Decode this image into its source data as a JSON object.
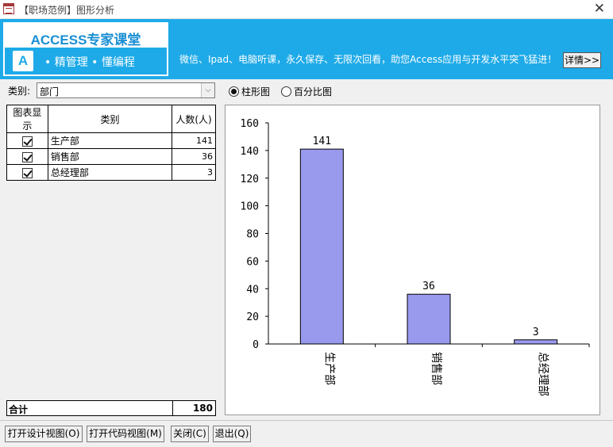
{
  "window": {
    "title": "【职场范例】图形分析",
    "close_glyph": "✕"
  },
  "banner": {
    "logo_title": "ACCESS专家课堂",
    "logo_badge": "A",
    "logo_slogan": "•  精管理  •  懂编程",
    "text": "微信、Ipad、电脑听课，永久保存、无限次回看，助您Access应用与开发水平突飞猛进！",
    "detail_button": "详情>>",
    "color": "#1eaae8"
  },
  "filter": {
    "label": "类别:",
    "value": "部门",
    "arrow": "⌵"
  },
  "chart_mode": {
    "options": [
      {
        "label": "柱形图",
        "selected": true
      },
      {
        "label": "百分比图",
        "selected": false
      }
    ]
  },
  "table": {
    "headers": [
      "图表显示",
      "类别",
      "人数(人)"
    ],
    "rows": [
      {
        "checked": true,
        "name": "生产部",
        "count": "141"
      },
      {
        "checked": true,
        "name": "销售部",
        "count": "36"
      },
      {
        "checked": true,
        "name": "总经理部",
        "count": "3"
      }
    ],
    "total_label": "合计",
    "total_value": "180"
  },
  "chart_data": {
    "type": "bar",
    "categories": [
      "生产部",
      "销售部",
      "总经理部"
    ],
    "values": [
      141,
      36,
      3
    ],
    "data_labels": [
      "141",
      "36",
      "3"
    ],
    "ylim": [
      0,
      160
    ],
    "yticks": [
      0,
      20,
      40,
      60,
      80,
      100,
      120,
      140,
      160
    ],
    "bar_color": "#9999ee",
    "grid": false,
    "legend": "none"
  },
  "buttons": {
    "design_view": "打开设计视图(O)",
    "code_view": "打开代码视图(M)",
    "close": "关闭(C)",
    "exit": "退出(Q)"
  }
}
